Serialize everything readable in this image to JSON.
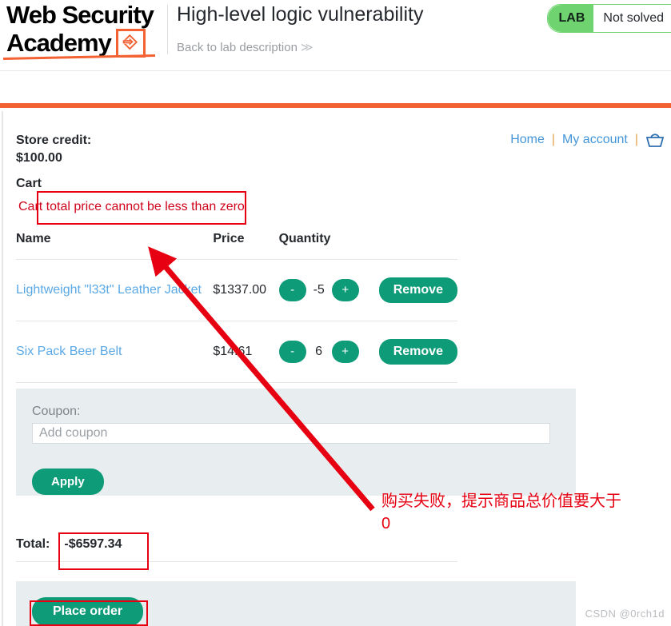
{
  "lab": {
    "brand_line1": "Web Security",
    "brand_line2": "Academy",
    "logo_bolt": "⚡",
    "title": "High-level logic vulnerability",
    "back_link": "Back to lab description",
    "back_chevron": "≫",
    "status_tag": "LAB",
    "status_text": "Not solved",
    "status_color": "#6fd36f"
  },
  "shop": {
    "nav": {
      "home": "Home",
      "my_account": "My account",
      "separator": "|",
      "basket_icon": "basket-icon"
    },
    "store_credit_label": "Store credit:",
    "store_credit_value": "$100.00",
    "cart_heading": "Cart",
    "cart_error": "Cart total price cannot be less than zero",
    "table": {
      "headers": [
        "Name",
        "Price",
        "Quantity",
        ""
      ],
      "rows": [
        {
          "name": "Lightweight \"l33t\" Leather Jacket",
          "price": "$1337.00",
          "qty": "-5",
          "decrement": "-",
          "increment": "+",
          "remove": "Remove"
        },
        {
          "name": "Six Pack Beer Belt",
          "price": "$14.61",
          "qty": "6",
          "decrement": "-",
          "increment": "+",
          "remove": "Remove"
        }
      ]
    },
    "coupon": {
      "label": "Coupon:",
      "placeholder": "Add coupon",
      "value": "",
      "apply": "Apply"
    },
    "total_label": "Total:",
    "total_value": "-$6597.34",
    "place_order": "Place order"
  },
  "annotation": {
    "note_line1": "购买失败，提示商品总价值要大于",
    "note_line2": "0",
    "color": "#e60012"
  },
  "watermark": "CSDN @0rch1d"
}
